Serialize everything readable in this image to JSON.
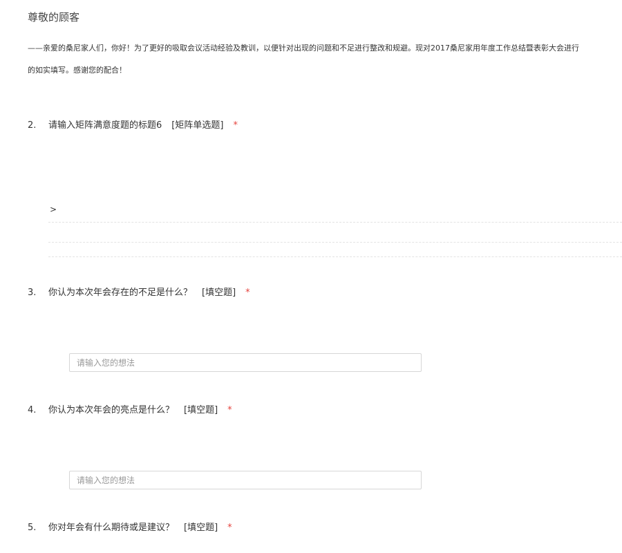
{
  "header": {
    "salutation": "尊敬的顾客",
    "intro_line_1": "——亲爱的桑尼家人们，你好！为了更好的吸取会议活动经验及教训，以便针对出现的问题和不足进行整改和规避。现对2017桑尼家用年度工作总结暨表彰大会进行",
    "intro_line_2": "的如实填写。感谢您的配合！"
  },
  "questions": [
    {
      "number": "2.",
      "title": "请输入矩阵满意度题的标题6",
      "type": "[矩阵单选题]",
      "required_mark": "*",
      "matrix_arrow": ">"
    },
    {
      "number": "3.",
      "title": "你认为本次年会存在的不足是什么？",
      "type": "[填空题]",
      "required_mark": "*",
      "placeholder": "请输入您的想法"
    },
    {
      "number": "4.",
      "title": "你认为本次年会的亮点是什么？",
      "type": "[填空题]",
      "required_mark": "*",
      "placeholder": "请输入您的想法"
    },
    {
      "number": "5.",
      "title": "你对年会有什么期待或是建议？",
      "type": "[填空题]",
      "required_mark": "*"
    }
  ],
  "colors": {
    "required": "#e5433d",
    "text": "#333333",
    "input_border": "#d6d6d6",
    "placeholder": "#999999"
  }
}
